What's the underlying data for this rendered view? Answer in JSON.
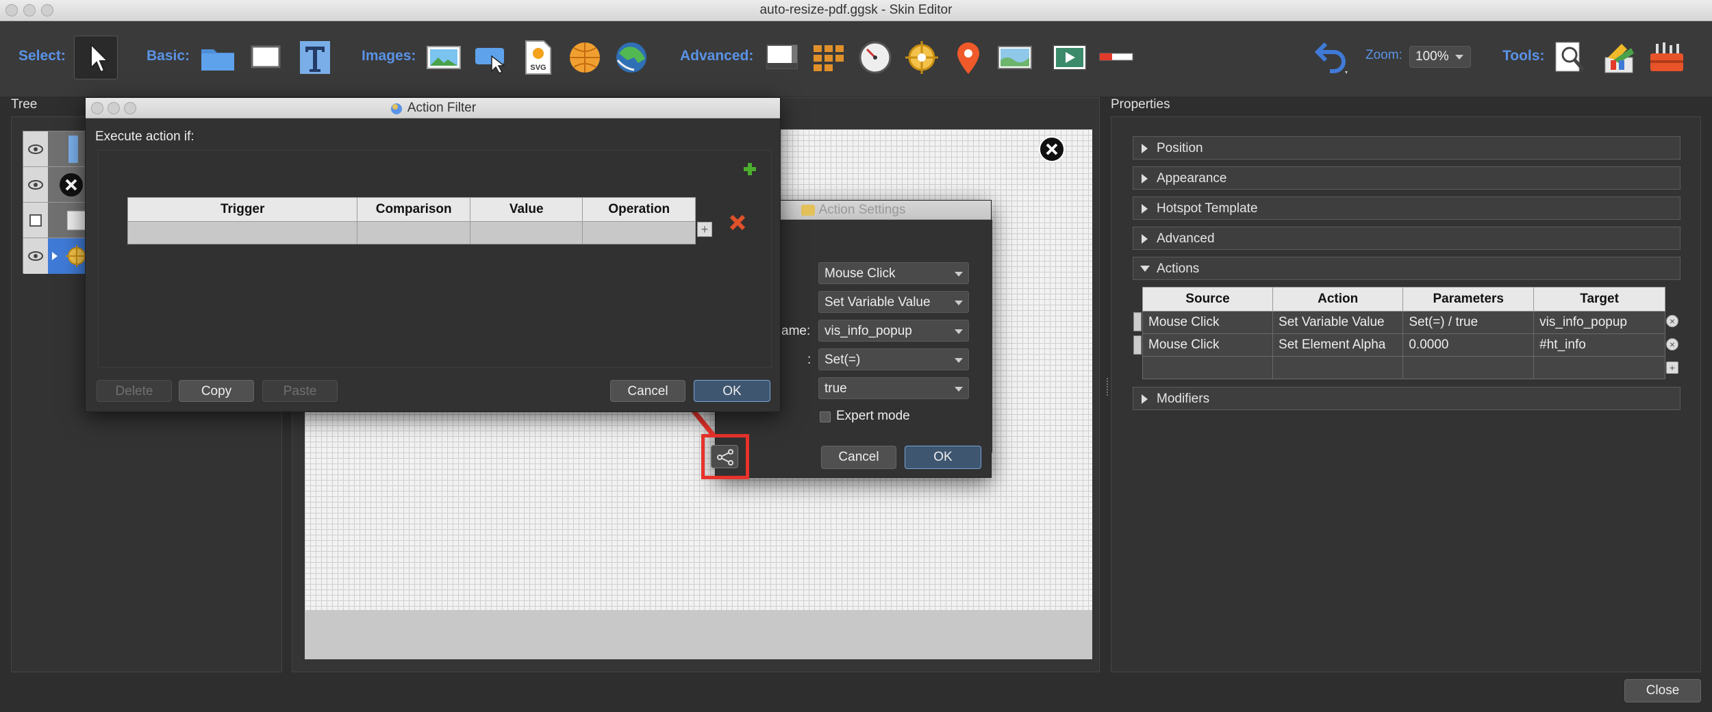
{
  "window": {
    "title": "auto-resize-pdf.ggsk - Skin Editor"
  },
  "toolbar": {
    "select_label": "Select:",
    "basic_label": "Basic:",
    "images_label": "Images:",
    "advanced_label": "Advanced:",
    "zoom_label": "Zoom:",
    "zoom_value": "100%",
    "tools_label": "Tools:",
    "svg_icon_text": "SVG"
  },
  "panels": {
    "tree_label": "Tree",
    "properties_label": "Properties"
  },
  "properties": {
    "sections": [
      "Position",
      "Appearance",
      "Hotspot Template",
      "Advanced",
      "Actions",
      "Modifiers"
    ],
    "actions_table": {
      "headers": [
        "Source",
        "Action",
        "Parameters",
        "Target"
      ],
      "rows": [
        [
          "Mouse Click",
          "Set Variable Value",
          "Set(=) / true",
          "vis_info_popup"
        ],
        [
          "Mouse Click",
          "Set Element Alpha",
          "0.0000",
          "#ht_info"
        ]
      ]
    }
  },
  "action_settings": {
    "title": "Action Settings",
    "source": "Mouse Click",
    "action": "Set Variable Value",
    "name_label_partial": "ame:",
    "name_value": "vis_info_popup",
    "op_label_partial": ":",
    "operation": "Set(=)",
    "value": "true",
    "expert_mode": "Expert mode",
    "cancel": "Cancel",
    "ok": "OK"
  },
  "action_filter": {
    "title": "Action Filter",
    "prompt": "Execute action if:",
    "headers": [
      "Trigger",
      "Comparison",
      "Value",
      "Operation"
    ],
    "delete": "Delete",
    "copy": "Copy",
    "paste": "Paste",
    "cancel": "Cancel",
    "ok": "OK"
  },
  "footer": {
    "close": "Close"
  },
  "colors": {
    "accent_label": "#5a93e6",
    "highlight": "#e8322b",
    "add_green": "#4caf2e",
    "remove_orange": "#e0522a"
  }
}
